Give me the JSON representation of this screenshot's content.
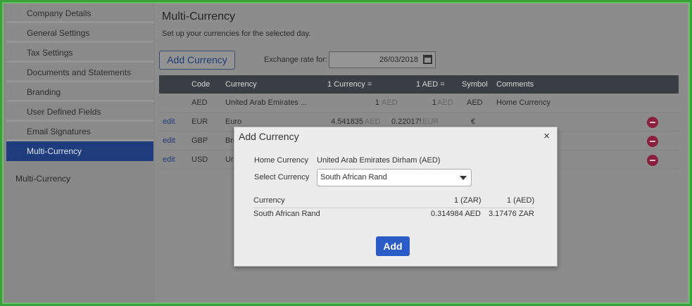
{
  "sidebar": {
    "items": [
      {
        "label": "Company Details"
      },
      {
        "label": "General Settings"
      },
      {
        "label": "Tax Settings"
      },
      {
        "label": "Documents and Statements"
      },
      {
        "label": "Branding"
      },
      {
        "label": "User Defined Fields"
      },
      {
        "label": "Email Signatures"
      },
      {
        "label": "Multi-Currency"
      }
    ],
    "footer_label": "Multi-Currency"
  },
  "main": {
    "title": "Multi-Currency",
    "subtitle": "Set up your currencies for the selected day.",
    "add_button": "Add Currency",
    "rate_label": "Exchange rate for:",
    "rate_date": "26/03/2018",
    "columns": [
      "Code",
      "Currency",
      "1 Currency =",
      "1 AED =",
      "Symbol",
      "Comments"
    ],
    "rows": [
      {
        "edit": "",
        "code": "AED",
        "currency": "United Arab Emirates ...",
        "rate1": "1",
        "rate1_unit": "AED",
        "rate2": "1",
        "rate2_unit": "AED",
        "symbol": "AED",
        "comments": "Home Currency"
      },
      {
        "edit": "edit",
        "code": "EUR",
        "currency": "Euro",
        "rate1": "4.541835",
        "rate1_unit": "AED",
        "rate2": "0.220175",
        "rate2_unit": "EUR",
        "symbol": "€",
        "comments": ""
      },
      {
        "edit": "edit",
        "code": "GBP",
        "currency": "Bri",
        "rate1": "",
        "rate1_unit": "",
        "rate2": "",
        "rate2_unit": "",
        "symbol": "",
        "comments": ""
      },
      {
        "edit": "edit",
        "code": "USD",
        "currency": "Un",
        "rate1": "",
        "rate1_unit": "",
        "rate2": "",
        "rate2_unit": "",
        "symbol": "",
        "comments": ""
      }
    ]
  },
  "modal": {
    "title": "Add Currency",
    "close": "×",
    "home_label": "Home Currency",
    "home_value": "United Arab Emirates Dirham (AED)",
    "select_label": "Select Currency",
    "select_value": "South African Rand",
    "table_headers": [
      "Currency",
      "1 (ZAR)",
      "1 (AED)"
    ],
    "table_row": [
      "South African Rand",
      "0.314984 AED",
      "3.17476 ZAR"
    ],
    "add_button": "Add"
  },
  "colors": {
    "active_nav": "#1f3d7d",
    "primary_button": "#2a5bc6",
    "grid_header": "#3b3e44",
    "delete_icon": "#8a1f3e"
  }
}
